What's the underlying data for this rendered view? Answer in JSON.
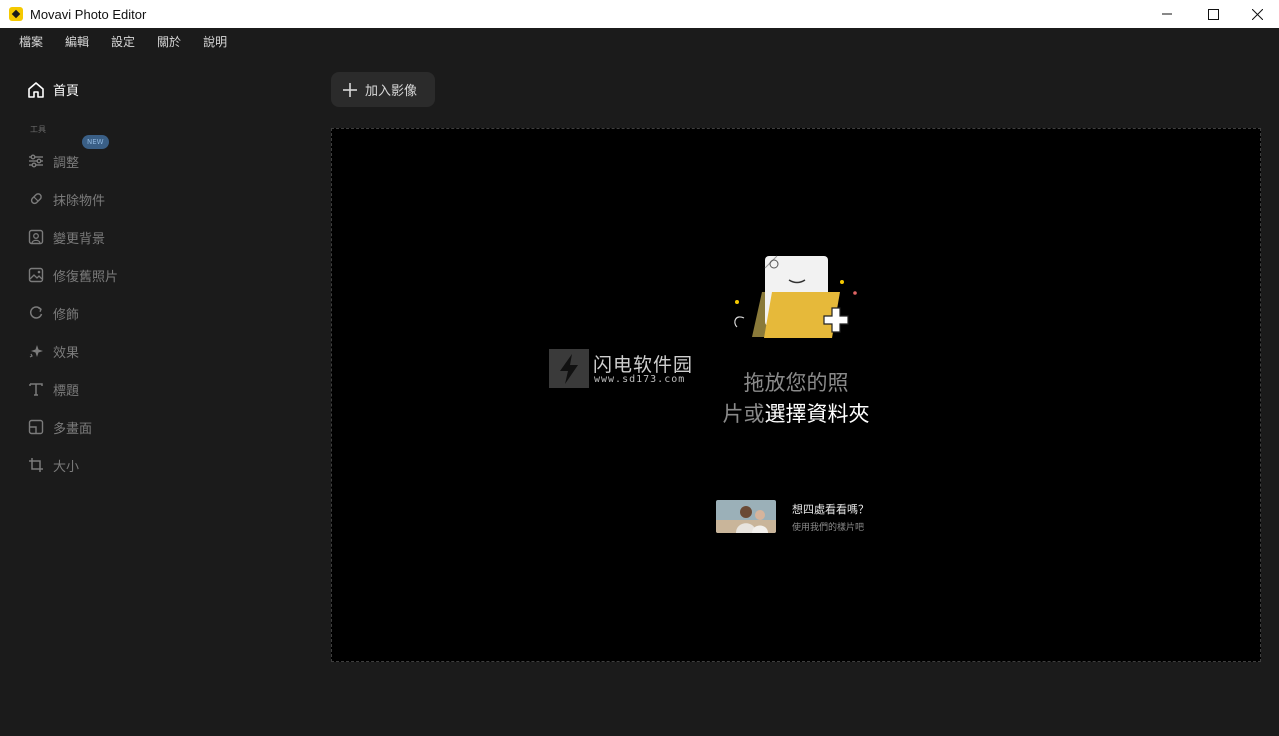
{
  "window": {
    "title": "Movavi Photo Editor",
    "controls": [
      "minimize-icon",
      "maximize-icon",
      "close-icon"
    ]
  },
  "menu": [
    "檔案",
    "編輯",
    "設定",
    "關於",
    "說明"
  ],
  "sidebar": {
    "home": {
      "label": "首頁",
      "icon": "home-icon"
    },
    "tools_heading": "工具",
    "new_badge": "NEW",
    "items": [
      {
        "label": "調整",
        "icon": "sliders-icon"
      },
      {
        "label": "抹除物件",
        "icon": "eraser-icon"
      },
      {
        "label": "變更背景",
        "icon": "portrait-icon"
      },
      {
        "label": "修復舊照片",
        "icon": "photo-restore-icon"
      },
      {
        "label": "修飾",
        "icon": "retouch-icon"
      },
      {
        "label": "效果",
        "icon": "sparkle-icon"
      },
      {
        "label": "標題",
        "icon": "text-icon"
      },
      {
        "label": "多畫面",
        "icon": "frames-icon"
      },
      {
        "label": "大小",
        "icon": "crop-icon"
      }
    ]
  },
  "toolbar": {
    "add_images_label": "加入影像"
  },
  "dropzone": {
    "line1": "拖放您的照",
    "line2_prefix": "片或",
    "line2_link": "選擇資料夾"
  },
  "watermark": {
    "title": "闪电软件园",
    "url": "www.sd173.com"
  },
  "sample": {
    "title": "想四處看看嗎？",
    "subtitle": "使用我們的樣片吧"
  },
  "colors": {
    "accent": "#f5c900",
    "folder": "#e6b93a",
    "background": "#1b1b1b",
    "canvas": "#000000"
  }
}
